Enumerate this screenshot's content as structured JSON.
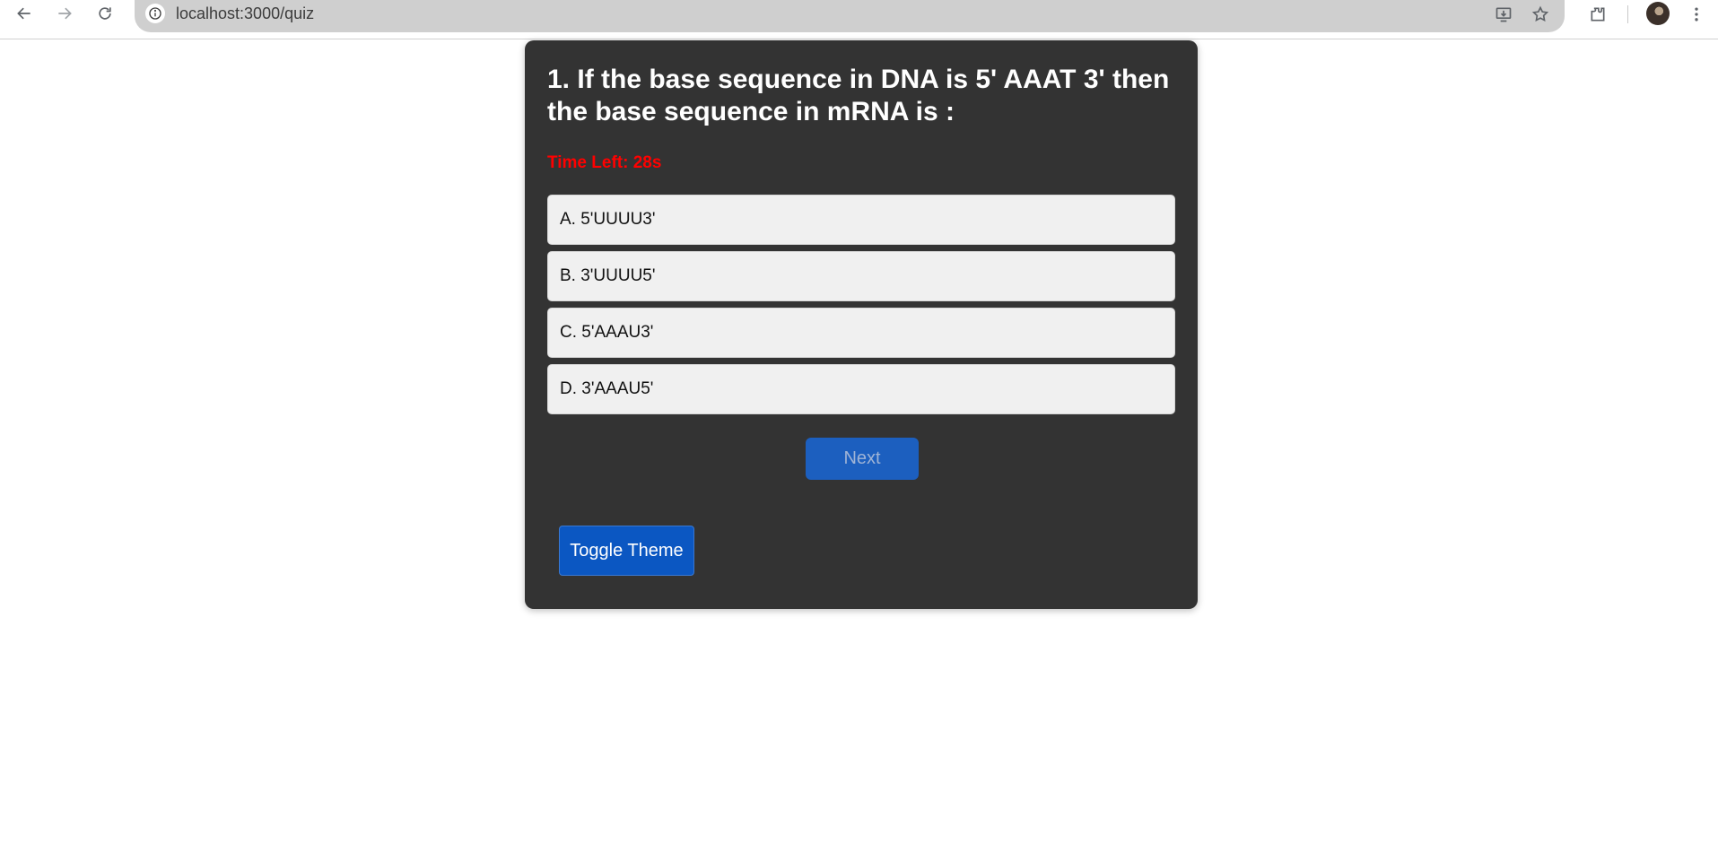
{
  "browser": {
    "url": "localhost:3000/quiz",
    "nav_icons": [
      "back-arrow-icon",
      "forward-arrow-icon",
      "reload-icon"
    ],
    "omnibox_actions": [
      "install-app-icon",
      "bookmark-star-icon"
    ],
    "toolbar_icons": [
      "extensions-icon",
      "profile-avatar",
      "more-menu-icon"
    ]
  },
  "quiz": {
    "question": "1. If the base sequence in DNA is 5' AAAT 3' then the base sequence in mRNA is :",
    "timer_text": "Time Left: 28s",
    "options": [
      {
        "label": "A. 5'UUUU3'"
      },
      {
        "label": "B. 3'UUUU5'"
      },
      {
        "label": "C. 5'AAAU3'"
      },
      {
        "label": "D. 3'AAAU5'"
      }
    ],
    "next_label": "Next",
    "toggle_theme_label": "Toggle Theme"
  },
  "colors": {
    "card_background": "#333333",
    "timer": "#ff0000",
    "option_background": "#f0f0f0",
    "next_button": "#1c5fbf",
    "toggle_button": "#0b57c2"
  }
}
